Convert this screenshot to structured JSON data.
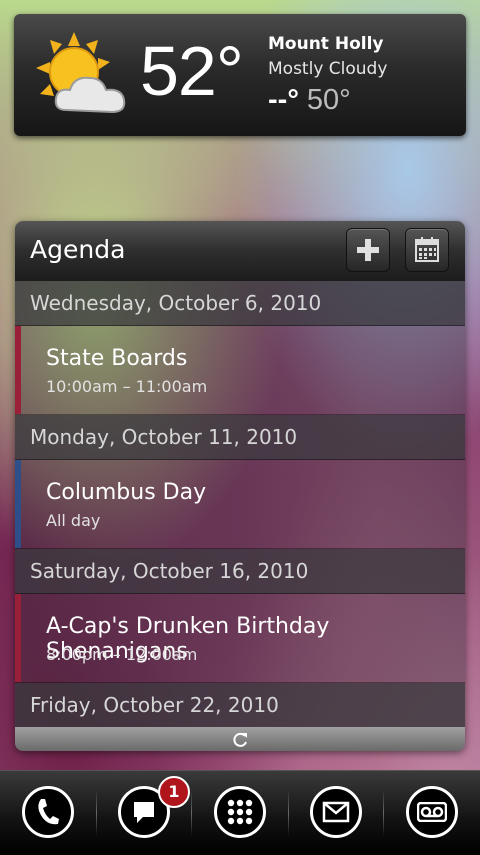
{
  "weather": {
    "icon": "partly-cloudy-icon",
    "temperature": "52°",
    "location": "Mount Holly",
    "condition": "Mostly Cloudy",
    "high": "--°",
    "low": "50°"
  },
  "agenda": {
    "title": "Agenda",
    "add_icon": "plus-icon",
    "calendar_icon": "calendar-icon",
    "refresh_icon": "refresh-icon",
    "days": [
      {
        "date": "Wednesday, October 6, 2010",
        "events": [
          {
            "title": "State Boards",
            "time": "10:00am – 11:00am",
            "color": "#9a1f38"
          }
        ]
      },
      {
        "date": "Monday, October 11, 2010",
        "events": [
          {
            "title": "Columbus Day",
            "time": "All day",
            "color": "#2f4f8a"
          }
        ]
      },
      {
        "date": "Saturday, October 16, 2010",
        "events": [
          {
            "title": "A-Cap's Drunken Birthday Shenanigans",
            "time": "8:00pm – 12:00am",
            "color": "#9a1f38"
          }
        ]
      },
      {
        "date": "Friday, October 22, 2010",
        "events": []
      }
    ]
  },
  "dock": {
    "items": [
      {
        "icon": "phone-icon"
      },
      {
        "icon": "messaging-icon",
        "badge": "1"
      },
      {
        "icon": "app-drawer-icon"
      },
      {
        "icon": "email-icon"
      },
      {
        "icon": "voicemail-icon"
      }
    ]
  },
  "colors": {
    "badge": "#b0151c",
    "event_red": "#9a1f38",
    "event_blue": "#2f4f8a"
  }
}
